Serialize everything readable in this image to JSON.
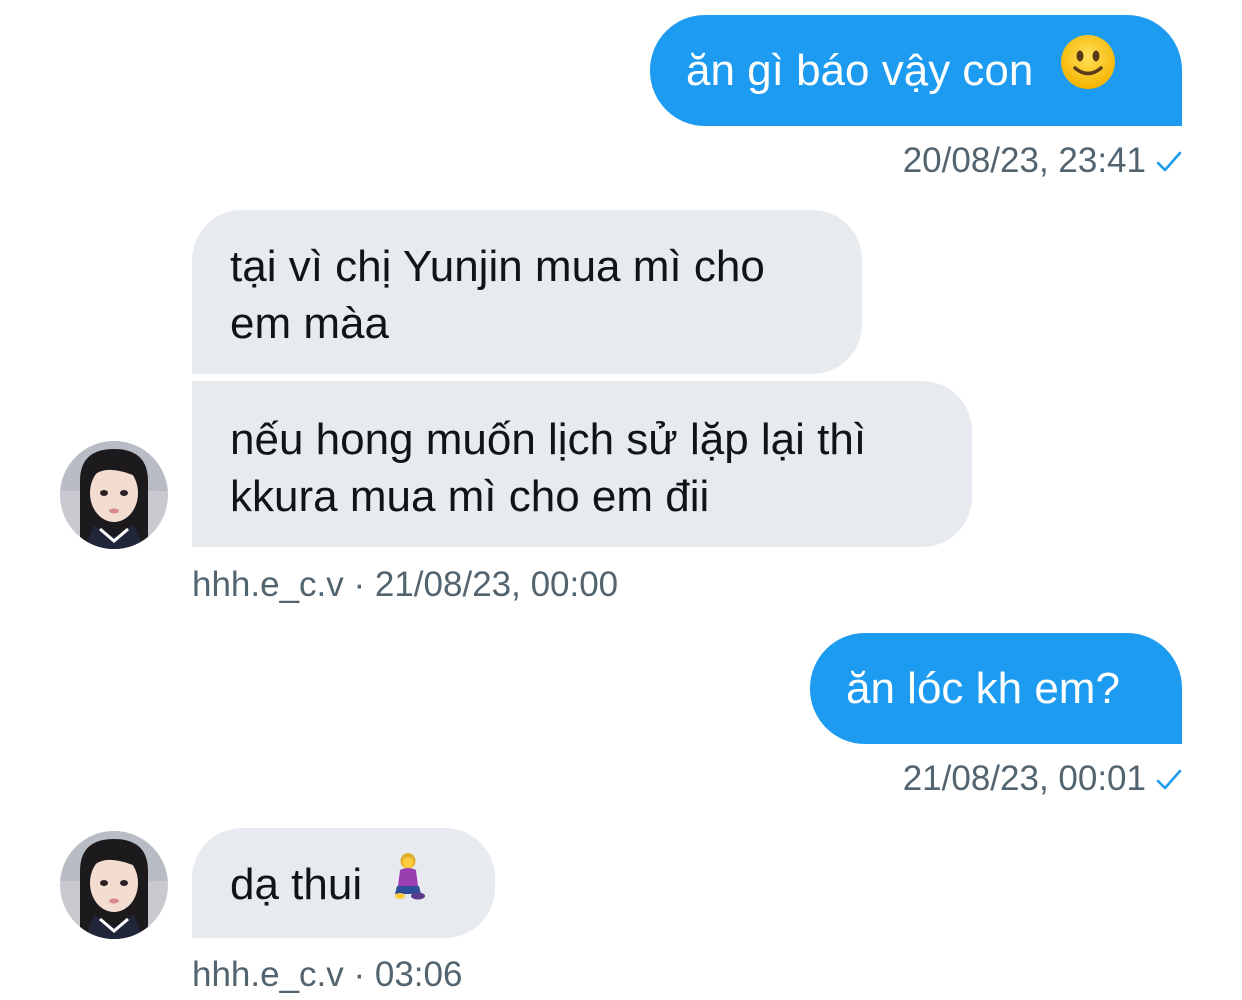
{
  "conversation": {
    "messages": [
      {
        "direction": "outgoing",
        "text": "ăn gì báo vậy con",
        "emoji": "slightly-smiling-face",
        "meta": "20/08/23, 23:41"
      },
      {
        "direction": "incoming",
        "text": "tại vì chị Yunjin mua mì cho em màa"
      },
      {
        "direction": "incoming",
        "text": "nếu hong muốn lịch sử lặp lại thì kkura mua mì cho em đii",
        "meta": "hhh.e_c.v · 21/08/23, 00:00"
      },
      {
        "direction": "outgoing",
        "text": "ăn lóc kh em?",
        "meta": "21/08/23, 00:01"
      },
      {
        "direction": "incoming",
        "text": "dạ thui",
        "emoji": "woman-kneeling",
        "meta": "hhh.e_c.v · 03:06"
      }
    ]
  },
  "colors": {
    "outgoing_bubble": "#1d9bf0",
    "incoming_bubble": "#e7eaef",
    "meta_text": "#536471",
    "check": "#1d9bf0"
  }
}
